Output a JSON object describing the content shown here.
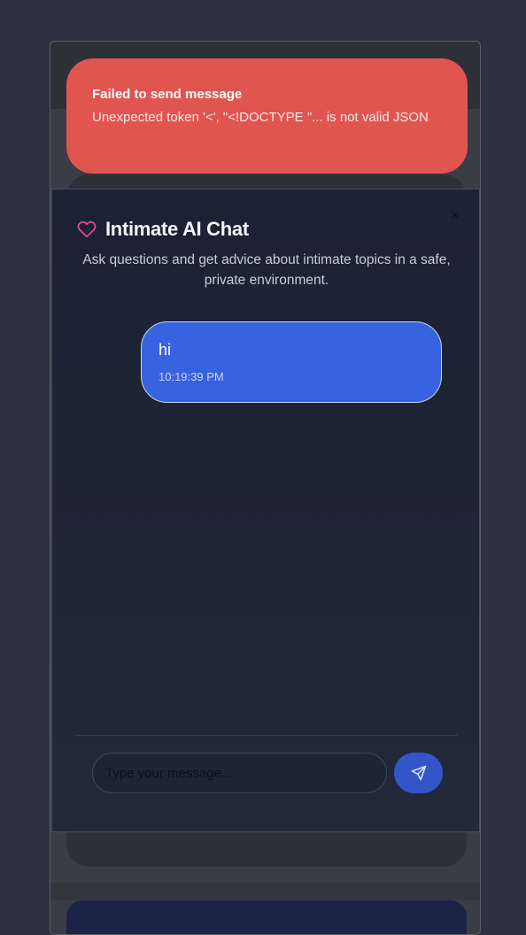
{
  "toast": {
    "title": "Failed to send message",
    "description": "Unexpected token '<', \"<!DOCTYPE \"... is not valid JSON",
    "color": "#e05550"
  },
  "modal": {
    "close_label": "×",
    "title": "Intimate AI Chat",
    "title_icon": "heart-icon",
    "subtitle": "Ask questions and get advice about intimate topics in a safe, private environment.",
    "messages": [
      {
        "role": "user",
        "text": "hi",
        "time": "10:19:39 PM"
      }
    ],
    "input": {
      "placeholder": "Type your message...",
      "value": ""
    },
    "send_icon": "send-icon",
    "accent": "#3763e0"
  }
}
